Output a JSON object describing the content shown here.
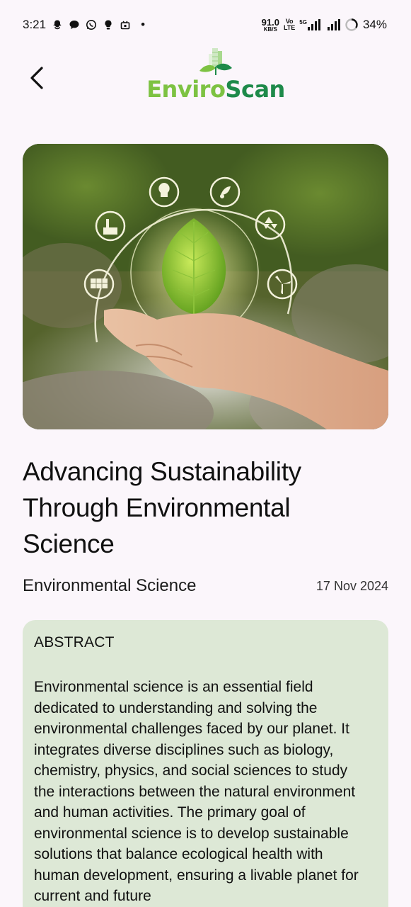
{
  "status_bar": {
    "time": "3:21",
    "dot": "•",
    "net_speed": "91.0",
    "net_unit": "KB/S",
    "volte_top": "Vo",
    "volte_bottom": "LTE",
    "network_gen": "5G",
    "battery": "34%",
    "battery_level": 0.34,
    "icons": [
      "snapchat-icon",
      "chat-icon",
      "whatsapp-icon",
      "bulb-icon",
      "app-icon"
    ]
  },
  "header": {
    "logo_part1": "Enviro",
    "logo_part2": "Scan",
    "brand_light": "#7dc242",
    "brand_dark": "#1e8a4a"
  },
  "article": {
    "title": "Advancing Sustainability Through Environmental Science",
    "category": "Environmental Science",
    "date": "17 Nov 2024",
    "abstract_heading": "ABSTRACT",
    "abstract_text": "Environmental science is an essential field dedicated to understanding and solving the environmental challenges faced by our planet. It integrates diverse disciplines such as biology, chemistry, physics, and social sciences to study the interactions between the natural environment and human activities. The primary goal of environmental science is to develop sustainable solutions that balance ecological health with human development, ensuring a livable planet for current and future"
  },
  "colors": {
    "background": "#fbf6fb",
    "abstract_card": "#dde8d6"
  }
}
